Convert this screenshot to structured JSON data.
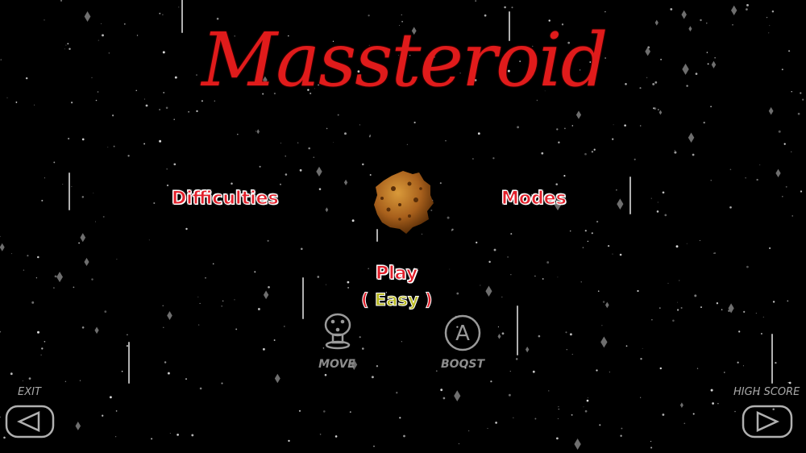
{
  "game": {
    "title": "Massteroid"
  },
  "menu": {
    "difficulties_label": "Difficulties",
    "modes_label": "Modes",
    "play_label": "Play",
    "level_open": "(",
    "level_value": "Easy",
    "level_close": ")"
  },
  "controls": {
    "move_label": "MOVE",
    "boost_label": "BOOST",
    "boost_glyph": "A"
  },
  "nav": {
    "exit_label": "EXIT",
    "high_score_label": "HIGH SCORE"
  },
  "colors": {
    "title": "#e01b1b",
    "menu_text": "#e21f2a",
    "level_text": "#b8b820",
    "asteroid": "#b36a1f",
    "control_gray": "#9a9a9a"
  },
  "icons": [
    "joystick-icon",
    "a-button-icon",
    "left-arrow-icon",
    "right-arrow-icon",
    "asteroid-icon"
  ]
}
